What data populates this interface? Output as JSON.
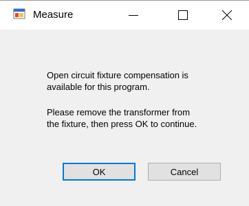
{
  "window": {
    "title": "Measure",
    "icon": "measure-app-icon",
    "controls": [
      "minimize-icon",
      "maximize-icon",
      "close-icon"
    ]
  },
  "message": {
    "paragraph1": [
      "Open circuit fixture compensation is",
      "available for this program."
    ],
    "paragraph2": [
      "Please remove the transformer from",
      "the fixture, then press OK to continue."
    ]
  },
  "buttons": {
    "ok_label": "OK",
    "cancel_label": "Cancel"
  },
  "colors": {
    "title_bar": "#ffffff",
    "dialog_body": "#f0f0f0",
    "button_face": "#e1e1e1",
    "default_button_accent": "#0078d7"
  }
}
